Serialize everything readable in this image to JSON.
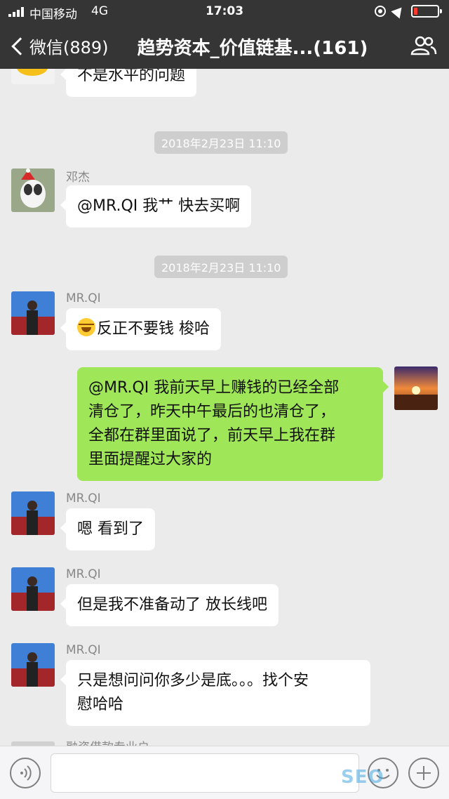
{
  "status_bar": {
    "carrier": "中国移动",
    "network": "4G",
    "time": "17:03",
    "icons": [
      "signal-icon",
      "lock-rotation-icon",
      "location-icon",
      "battery-low-icon"
    ],
    "battery_level": 0.15
  },
  "nav": {
    "back_label": "微信(889)",
    "title": "趋势资本_价值链基...(161)",
    "group_icon": "group-members-icon"
  },
  "messages": [
    {
      "type": "text",
      "side": "left",
      "sender": "",
      "text": "不是水平的问题"
    },
    {
      "type": "time",
      "text": "2018年2月23日 11:10"
    },
    {
      "type": "text",
      "side": "left",
      "sender": "邓杰",
      "text": "@MR.QI 我艹 快去买啊"
    },
    {
      "type": "time",
      "text": "2018年2月23日 11:10"
    },
    {
      "type": "text",
      "side": "left",
      "sender": "MR.QI",
      "emoji": "laugh-cry-emoji",
      "text": "反正不要钱  梭哈"
    },
    {
      "type": "text",
      "side": "right",
      "lines": [
        "@MR.QI 我前天早上赚钱的已经全部",
        "清仓了，昨天中午最后的也清仓了，",
        "全都在群里面说了，前天早上我在群",
        "里面提醒过大家的"
      ]
    },
    {
      "type": "text",
      "side": "left",
      "sender": "MR.QI",
      "text": "嗯 看到了"
    },
    {
      "type": "text",
      "side": "left",
      "sender": "MR.QI",
      "text": "但是我不准备动了  放长线吧"
    },
    {
      "type": "text",
      "side": "left",
      "sender": "MR.QI",
      "lines": [
        "只是想问问你多少是底。。。找个安",
        "慰哈哈"
      ]
    },
    {
      "type": "partial",
      "sender": "融资借款专业户"
    }
  ],
  "input_bar": {
    "voice_icon": "voice-icon",
    "placeholder": "",
    "emoji_icon": "emoji-icon",
    "plus_icon": "plus-icon"
  },
  "watermark": "SEO"
}
